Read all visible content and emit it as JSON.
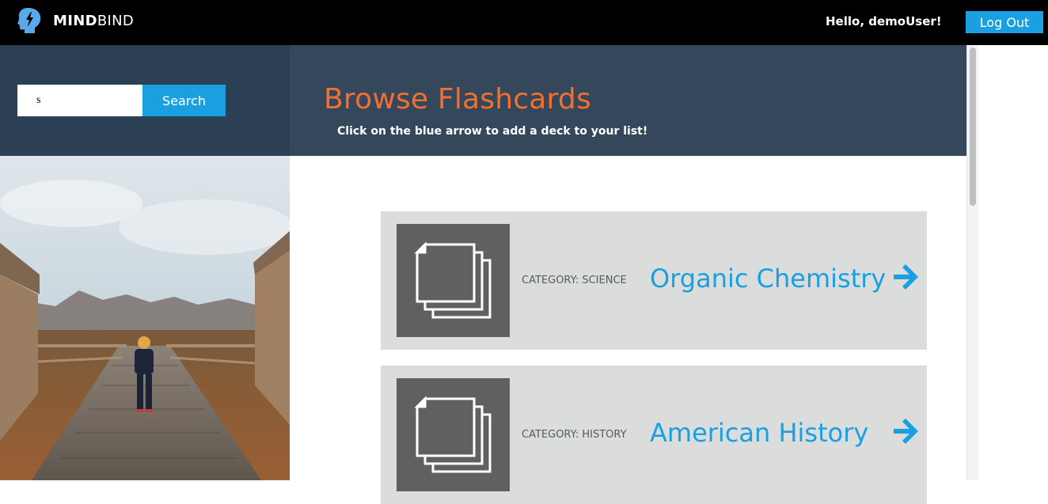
{
  "header": {
    "brand_bold": "MIND",
    "brand_regular": "BIND",
    "greeting": "Hello, demoUser!",
    "logout_label": "Log Out"
  },
  "sidebar": {
    "search_value": "s",
    "search_button": "Search",
    "photo_icon": "boardwalk-photo"
  },
  "main": {
    "title": "Browse Flashcards",
    "subtitle": "Click on the blue arrow to add a deck to your list!",
    "decks": [
      {
        "category": "CATEGORY: SCIENCE",
        "title": "Organic Chemistry",
        "icon": "cards-stack-icon"
      },
      {
        "category": "CATEGORY: HISTORY",
        "title": "American History",
        "icon": "cards-stack-icon"
      }
    ]
  },
  "colors": {
    "accent_blue": "#1aa0e1",
    "title_orange": "#f26f32",
    "sidebar_header": "#2b3f55",
    "main_header": "#35475a",
    "deck_bg": "#dbdcdc"
  }
}
